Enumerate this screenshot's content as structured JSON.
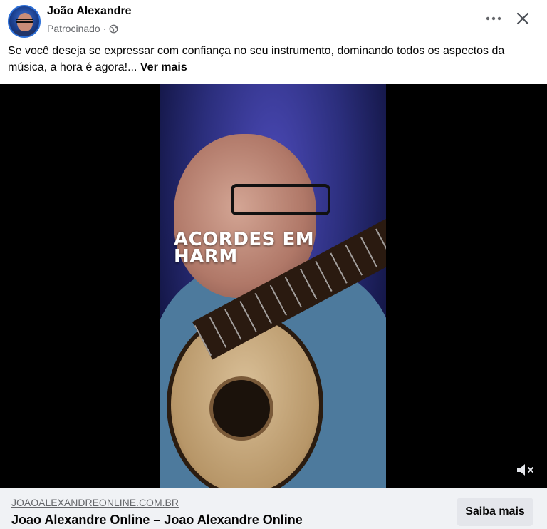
{
  "post": {
    "author": "João Alexandre",
    "sponsored_label": "Patrocinado",
    "separator": "·",
    "privacy_icon": "globe-icon",
    "more_icon": "more-options-icon",
    "close_icon": "close-icon",
    "caption_text": "Se você deseja se expressar com confiança no seu instrumento, dominando todos os aspectos da música, a hora é agora!...",
    "see_more_label": "Ver mais"
  },
  "media": {
    "overlay_text": "ACORDES EM HARM",
    "mute_icon": "muted-speaker-icon"
  },
  "link": {
    "domain": "JOAOALEXANDREONLINE.COM.BR",
    "title": "Joao Alexandre Online – Joao Alexandre Online",
    "cta_label": "Saiba mais"
  },
  "colors": {
    "text_primary": "#050505",
    "text_secondary": "#65676b",
    "link_bar_bg": "#f0f2f5",
    "button_bg": "#e4e6eb"
  }
}
